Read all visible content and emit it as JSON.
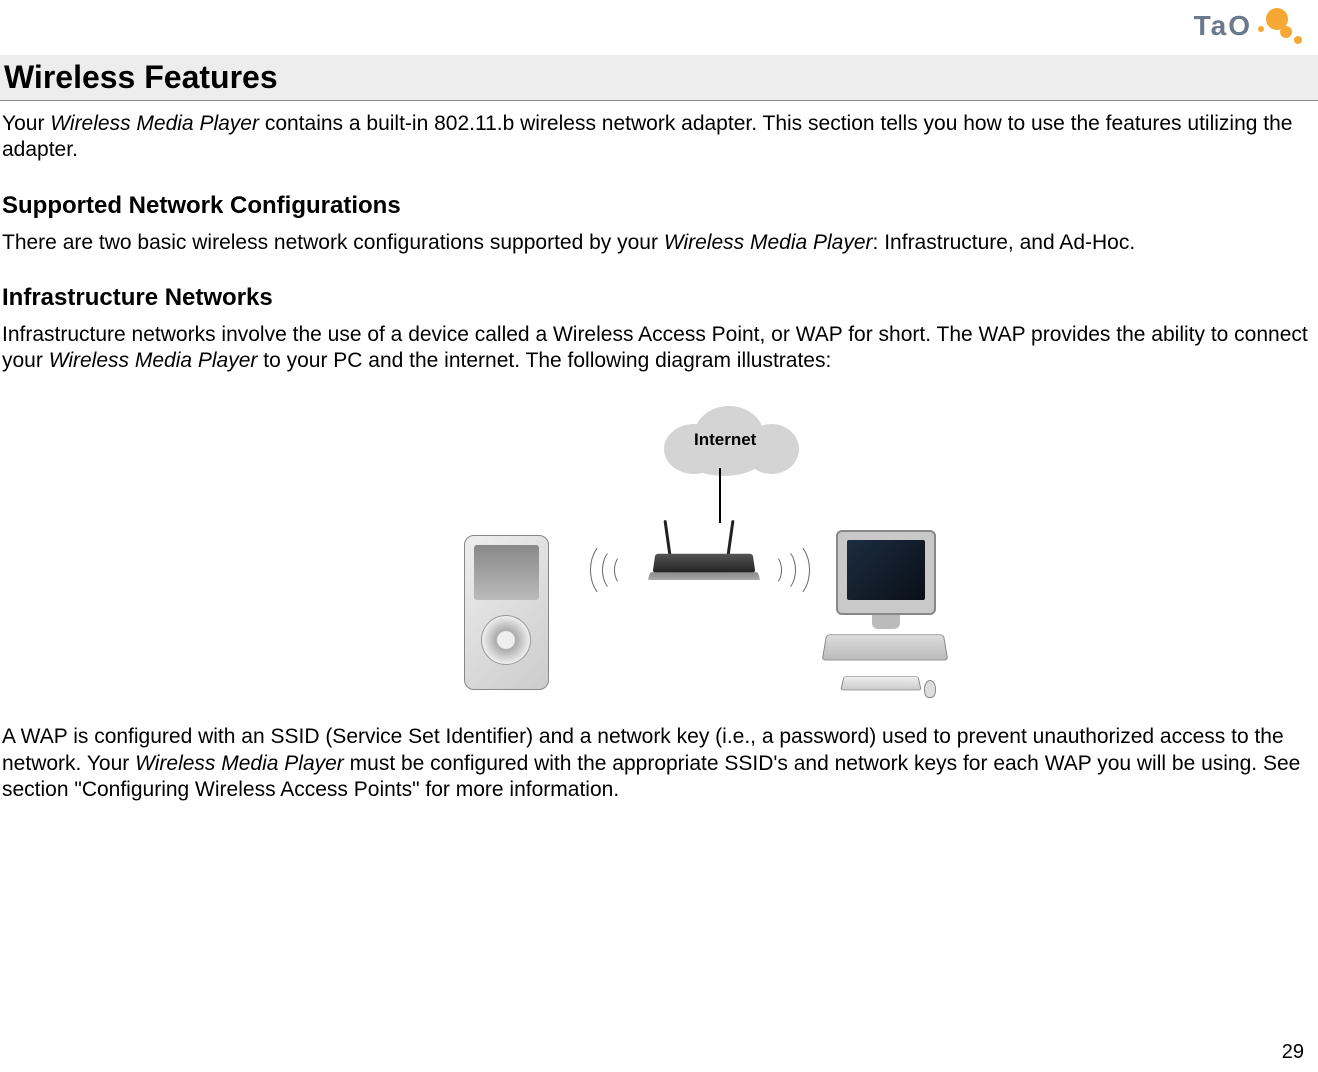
{
  "logo": {
    "text": "TaO"
  },
  "content": {
    "h1": "Wireless Features",
    "p1_a": "Your ",
    "p1_b": "Wireless Media Player",
    "p1_c": " contains a built-in 802.11.b wireless network adapter.  This section tells you how to use the features utilizing the adapter.",
    "h2a": "Supported Network Configurations",
    "p2_a": "There are two basic wireless network configurations supported by your ",
    "p2_b": "Wireless Media Player",
    "p2_c": ": Infrastructure, and Ad-Hoc.",
    "h2b": "Infrastructure Networks",
    "p3_a": "Infrastructure networks involve the use of a device called a Wireless Access Point, or WAP for short.  The WAP provides the ability to connect your ",
    "p3_b": "Wireless Media Player",
    "p3_c": " to your PC and the internet.  The following diagram illustrates:",
    "p4_a": "A WAP is configured with an SSID (Service Set Identifier) and a network key (i.e., a password) used to prevent unauthorized access to the network.  Your ",
    "p4_b": "Wireless Media Player",
    "p4_c": " must be configured with the appropriate SSID's and network keys for each WAP you will be using.  See section \"Configuring Wireless Access Points\" for more information."
  },
  "diagram": {
    "cloud_label": "Internet"
  },
  "page_number": "29"
}
